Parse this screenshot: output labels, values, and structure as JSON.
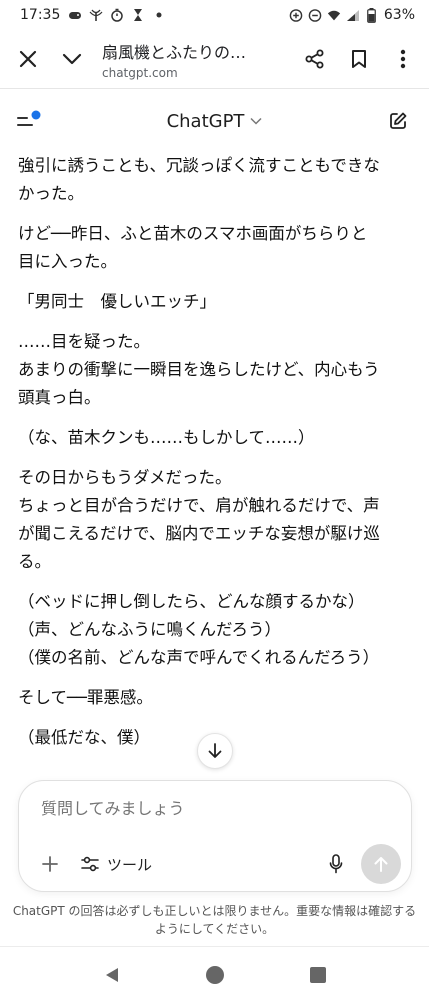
{
  "status_bar": {
    "time": "17:35",
    "battery": "63%",
    "left_icons": [
      "game-controller-icon",
      "antenna-icon",
      "stopwatch-icon",
      "hourglass-icon",
      "dot-icon"
    ],
    "right_icons": [
      "data-saver-icon",
      "dnd-icon",
      "wifi-icon",
      "signal-icon",
      "battery-icon"
    ]
  },
  "browser": {
    "page_title": "扇風機とふたりの…",
    "url": "chatgpt.com",
    "icons": [
      "close-icon",
      "chevron-down-icon",
      "share-icon",
      "bookmark-icon",
      "more-icon"
    ]
  },
  "header": {
    "title": "ChatGPT",
    "icons": [
      "menu-icon",
      "chevron-down-icon",
      "new-chat-icon"
    ],
    "accent_color": "#1a73e8"
  },
  "message": {
    "lines": [
      "強引に誘うことも、冗談っぽく流すこともできな",
      "かった。",
      "けど──昨日、ふと苗木のスマホ画面がちらりと",
      "目に入った。",
      "「男同士　優しいエッチ」",
      "……目を疑った。",
      "あまりの衝撃に一瞬目を逸らしたけど、内心もう",
      "頭真っ白。",
      "（な、苗木クンも……もしかして……）",
      "その日からもうダメだった。",
      "ちょっと目が合うだけで、肩が触れるだけで、声",
      "が聞こえるだけで、脳内でエッチな妄想が駆け巡",
      "る。",
      "（ベッドに押し倒したら、どんな顔するかな）",
      "（声、どんなふうに鳴くんだろう）",
      "（僕の名前、どんな声で呼んでくれるんだろう）",
      "そして──罪悪感。",
      "（最低だな、僕）"
    ]
  },
  "composer": {
    "placeholder": "質問してみましょう",
    "tools_label": "ツール",
    "icons": [
      "plus-icon",
      "tools-icon",
      "mic-icon",
      "send-arrow-icon"
    ]
  },
  "disclaimer": "ChatGPT の回答は必ずしも正しいとは限りません。重要な情報は確認するようにしてください。",
  "nav": {
    "icons": [
      "back-triangle-icon",
      "home-circle-icon",
      "recents-square-icon"
    ]
  }
}
